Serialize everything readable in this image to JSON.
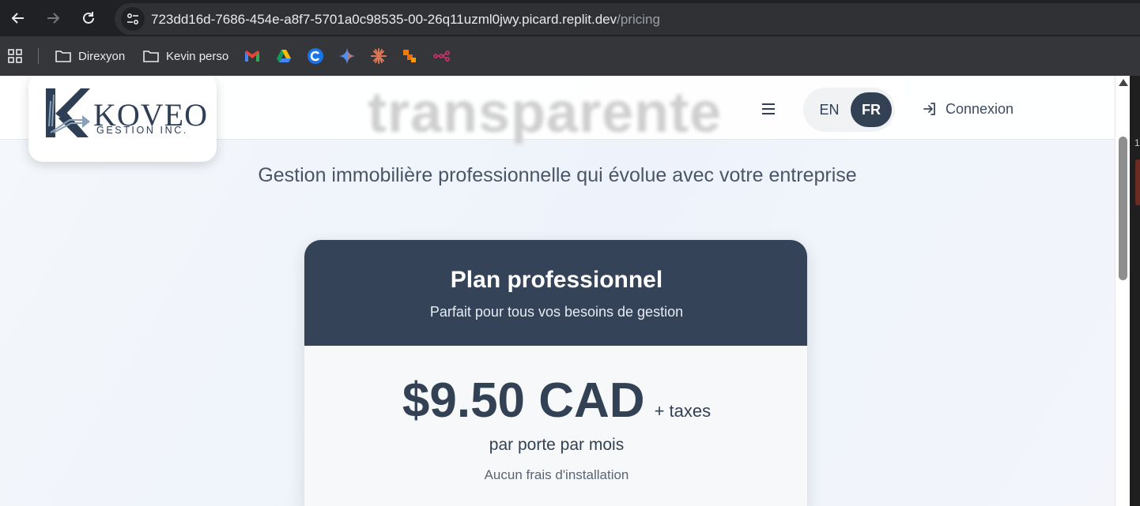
{
  "browser": {
    "url_host": "723dd16d-7686-454e-a8f7-5701a0c98535-00-26q11uzml0jwy.picard.replit.dev",
    "url_path": "/pricing",
    "bookmarks": [
      {
        "label": "Direxyon",
        "icon": "folder-icon"
      },
      {
        "label": "Kevin perso",
        "icon": "folder-icon"
      }
    ],
    "bookmark_icons": [
      "gmail-icon",
      "google-drive-icon",
      "c-app-icon",
      "gemini-icon",
      "claude-icon",
      "tasks-icon",
      "workflow-icon"
    ]
  },
  "header": {
    "ghost_heading": "transparente",
    "logo_name": "KOVEO",
    "logo_sub": "GESTION INC.",
    "lang_en": "EN",
    "lang_fr": "FR",
    "lang_selected": "FR",
    "login_label": "Connexion"
  },
  "main": {
    "subtitle": "Gestion immobilière professionnelle qui évolue avec votre entreprise",
    "plan": {
      "title": "Plan professionnel",
      "description": "Parfait pour tous vos besoins de gestion",
      "price": "$9.50 CAD",
      "taxes": "+ taxes",
      "per_unit": "par porte par mois",
      "no_fee": "Aucun frais d'installation"
    }
  },
  "scrollbar": {
    "edge_mark": "1"
  },
  "colors": {
    "brand_navy": "#334155",
    "card_header": "#344358",
    "chrome_dark": "#202124"
  }
}
